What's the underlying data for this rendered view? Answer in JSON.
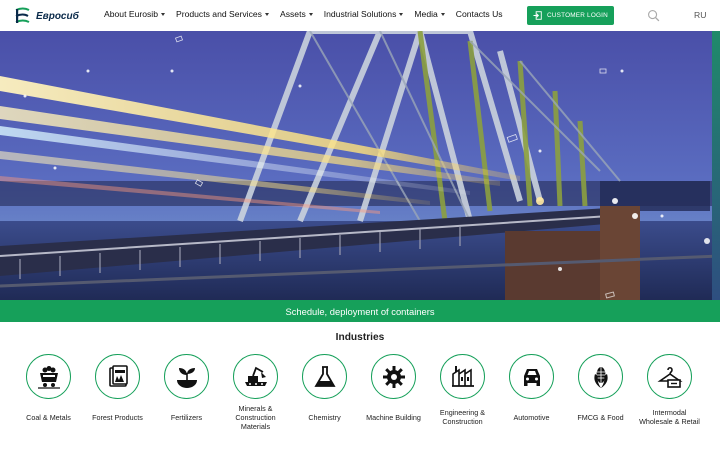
{
  "header": {
    "logo_text": "Евросиб",
    "nav": [
      {
        "label": "About Eurosib",
        "has_dropdown": true
      },
      {
        "label": "Products and Services",
        "has_dropdown": true
      },
      {
        "label": "Assets",
        "has_dropdown": true
      },
      {
        "label": "Industrial Solutions",
        "has_dropdown": true
      },
      {
        "label": "Media",
        "has_dropdown": true
      },
      {
        "label": "Contacts Us",
        "has_dropdown": false
      }
    ],
    "login_label": "CUSTOMER LOGIN",
    "language": "RU"
  },
  "hero": {
    "image": "railway bridge at dusk with passing train light trails",
    "banner_text": "Schedule, deployment of containers"
  },
  "industries": {
    "title": "Industries",
    "items": [
      {
        "label": "Coal & Metals",
        "icon": "coal-cart-icon"
      },
      {
        "label": "Forest Products",
        "icon": "forest-products-icon"
      },
      {
        "label": "Fertilizers",
        "icon": "sprout-icon"
      },
      {
        "label": "Minerals & Construction Materials",
        "icon": "excavator-icon"
      },
      {
        "label": "Chemistry",
        "icon": "flask-icon"
      },
      {
        "label": "Machine Building",
        "icon": "gear-icon"
      },
      {
        "label": "Engineering & Construction",
        "icon": "factory-icon"
      },
      {
        "label": "Automotive",
        "icon": "car-icon"
      },
      {
        "label": "FMCG & Food",
        "icon": "corn-icon"
      },
      {
        "label": "Intermodal Wholesale & Retail",
        "icon": "hanger-icon"
      }
    ]
  },
  "colors": {
    "accent_green": "#16a05a",
    "logo_blue": "#0a2a4a"
  }
}
